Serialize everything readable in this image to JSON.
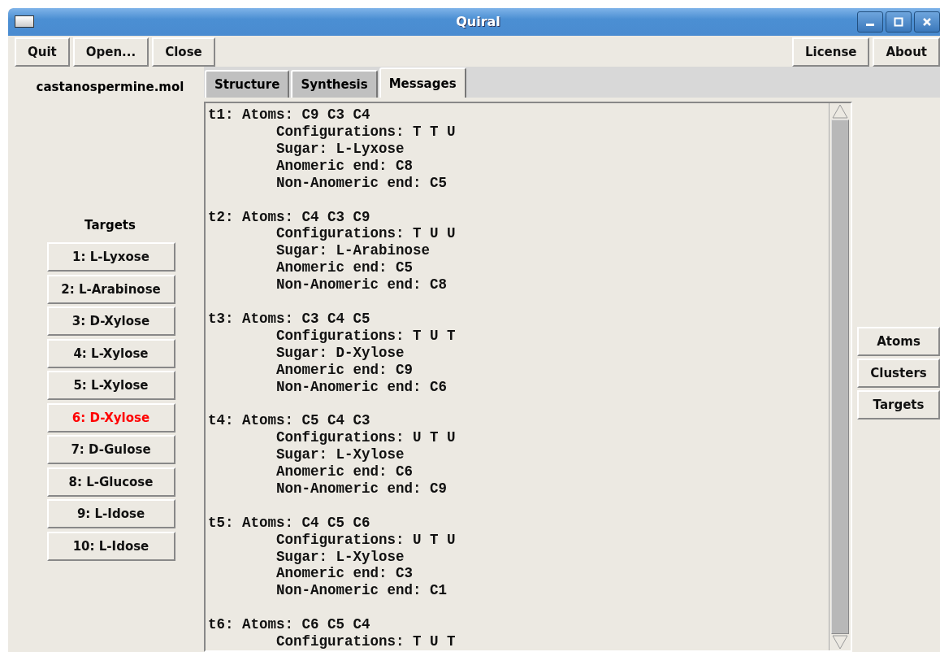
{
  "window": {
    "title": "Quiral"
  },
  "toolbar_left": [
    "Quit",
    "Open...",
    "Close"
  ],
  "toolbar_right": [
    "License",
    "About"
  ],
  "file_name": "castanospermine.mol",
  "targets": {
    "heading": "Targets",
    "items": [
      {
        "label": "1:  L-Lyxose",
        "selected": false
      },
      {
        "label": "2:  L-Arabinose",
        "selected": false
      },
      {
        "label": "3:  D-Xylose",
        "selected": false
      },
      {
        "label": "4:  L-Xylose",
        "selected": false
      },
      {
        "label": "5:  L-Xylose",
        "selected": false
      },
      {
        "label": "6:  D-Xylose",
        "selected": true
      },
      {
        "label": "7:  D-Gulose",
        "selected": false
      },
      {
        "label": "8:  L-Glucose",
        "selected": false
      },
      {
        "label": "9:  L-Idose",
        "selected": false
      },
      {
        "label": "10:  L-Idose",
        "selected": false
      }
    ]
  },
  "tabs": [
    {
      "label": "Structure",
      "selected": false
    },
    {
      "label": "Synthesis",
      "selected": false
    },
    {
      "label": "Messages",
      "selected": true
    }
  ],
  "messages": [
    {
      "head": "t1: Atoms: C9 C3 C4",
      "lines": [
        "Configurations: T T U",
        "Sugar: L-Lyxose",
        "Anomeric end: C8",
        "Non-Anomeric end: C5"
      ]
    },
    {
      "head": "t2: Atoms: C4 C3 C9",
      "lines": [
        "Configurations: T U U",
        "Sugar: L-Arabinose",
        "Anomeric end: C5",
        "Non-Anomeric end: C8"
      ]
    },
    {
      "head": "t3: Atoms: C3 C4 C5",
      "lines": [
        "Configurations: T U T",
        "Sugar: D-Xylose",
        "Anomeric end: C9",
        "Non-Anomeric end: C6"
      ]
    },
    {
      "head": "t4: Atoms: C5 C4 C3",
      "lines": [
        "Configurations: U T U",
        "Sugar: L-Xylose",
        "Anomeric end: C6",
        "Non-Anomeric end: C9"
      ]
    },
    {
      "head": "t5: Atoms: C4 C5 C6",
      "lines": [
        "Configurations: U T U",
        "Sugar: L-Xylose",
        "Anomeric end: C3",
        "Non-Anomeric end: C1"
      ]
    },
    {
      "head": "t6: Atoms: C6 C5 C4",
      "lines": [
        "Configurations: T U T"
      ]
    }
  ],
  "side_buttons": [
    "Atoms",
    "Clusters",
    "Targets"
  ]
}
